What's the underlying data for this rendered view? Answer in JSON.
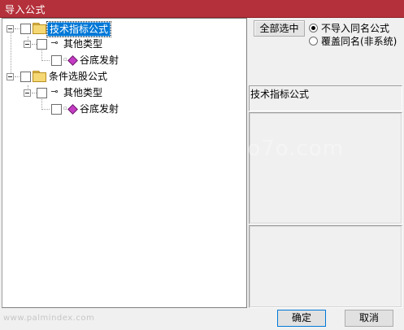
{
  "window": {
    "title": "导入公式"
  },
  "tree": {
    "groups": [
      {
        "label": "技术指标公式",
        "selected": true,
        "children": [
          {
            "label": "其他类型",
            "children": [
              {
                "label": "谷底发射"
              }
            ]
          }
        ]
      },
      {
        "label": "条件选股公式",
        "selected": false,
        "children": [
          {
            "label": "其他类型",
            "children": [
              {
                "label": "谷底发射"
              }
            ]
          }
        ]
      }
    ]
  },
  "options": {
    "select_all_label": "全部选中",
    "radio_options": [
      {
        "label": "不导入同名公式",
        "checked": true
      },
      {
        "label": "覆盖同名(非系统)",
        "checked": false
      }
    ]
  },
  "info": {
    "formula_name": "技术指标公式"
  },
  "footer": {
    "ok_label": "确定",
    "cancel_label": "取消"
  },
  "watermark": {
    "url": "u.6o7o.com",
    "bottom_text": "www.palmindex.com"
  }
}
